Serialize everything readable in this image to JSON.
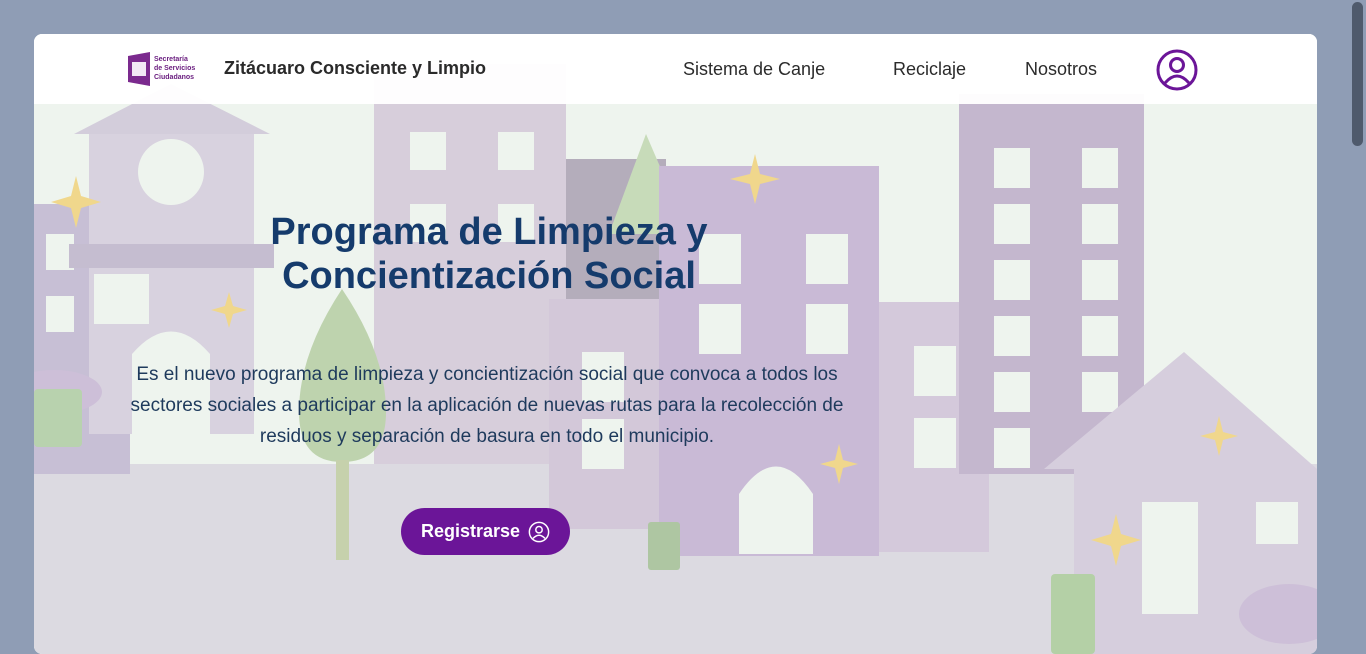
{
  "nav": {
    "brand": "Zitácuaro Consciente y Limpio",
    "logo_text": [
      "Secretaría",
      "de Servicios",
      "Ciudadanos"
    ],
    "links": [
      {
        "label": "Sistema de Canje"
      },
      {
        "label": "Reciclaje"
      },
      {
        "label": "Nosotros"
      }
    ],
    "user_icon": "user-circle-icon"
  },
  "hero": {
    "title": "Programa de Limpieza y Concientización Social",
    "description": "Es el nuevo programa de limpieza y concientización social que convoca a todos los sectores sociales a participar en la aplicación de nuevas rutas para la recolección de residuos y separación de basura en todo el municipio.",
    "cta_label": "Registrarse",
    "cta_icon": "user-circle-icon"
  },
  "colors": {
    "accent": "#6b1598",
    "title": "#153b6c",
    "text": "#1e3a5c",
    "page_bg": "#8f9db5"
  }
}
